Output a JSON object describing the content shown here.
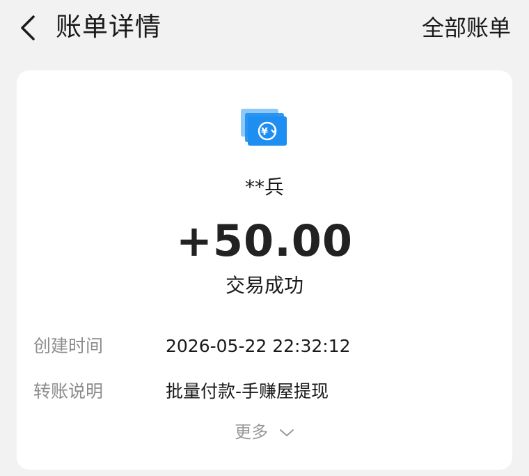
{
  "header": {
    "title": "账单详情",
    "all_bills_label": "全部账单"
  },
  "transaction": {
    "icon": "transfer-yuan-icon",
    "counterparty": "**兵",
    "amount": "+50.00",
    "status": "交易成功"
  },
  "details": [
    {
      "label": "创建时间",
      "value": "2026-05-22 22:32:12"
    },
    {
      "label": "转账说明",
      "value": "批量付款-手赚屋提现"
    }
  ],
  "more_label": "更多",
  "colors": {
    "background": "#f2f2f2",
    "card": "#ffffff",
    "icon_front": "#1f8ef1",
    "icon_back": "#8ec8f7",
    "label_gray": "#8c8c8c"
  }
}
